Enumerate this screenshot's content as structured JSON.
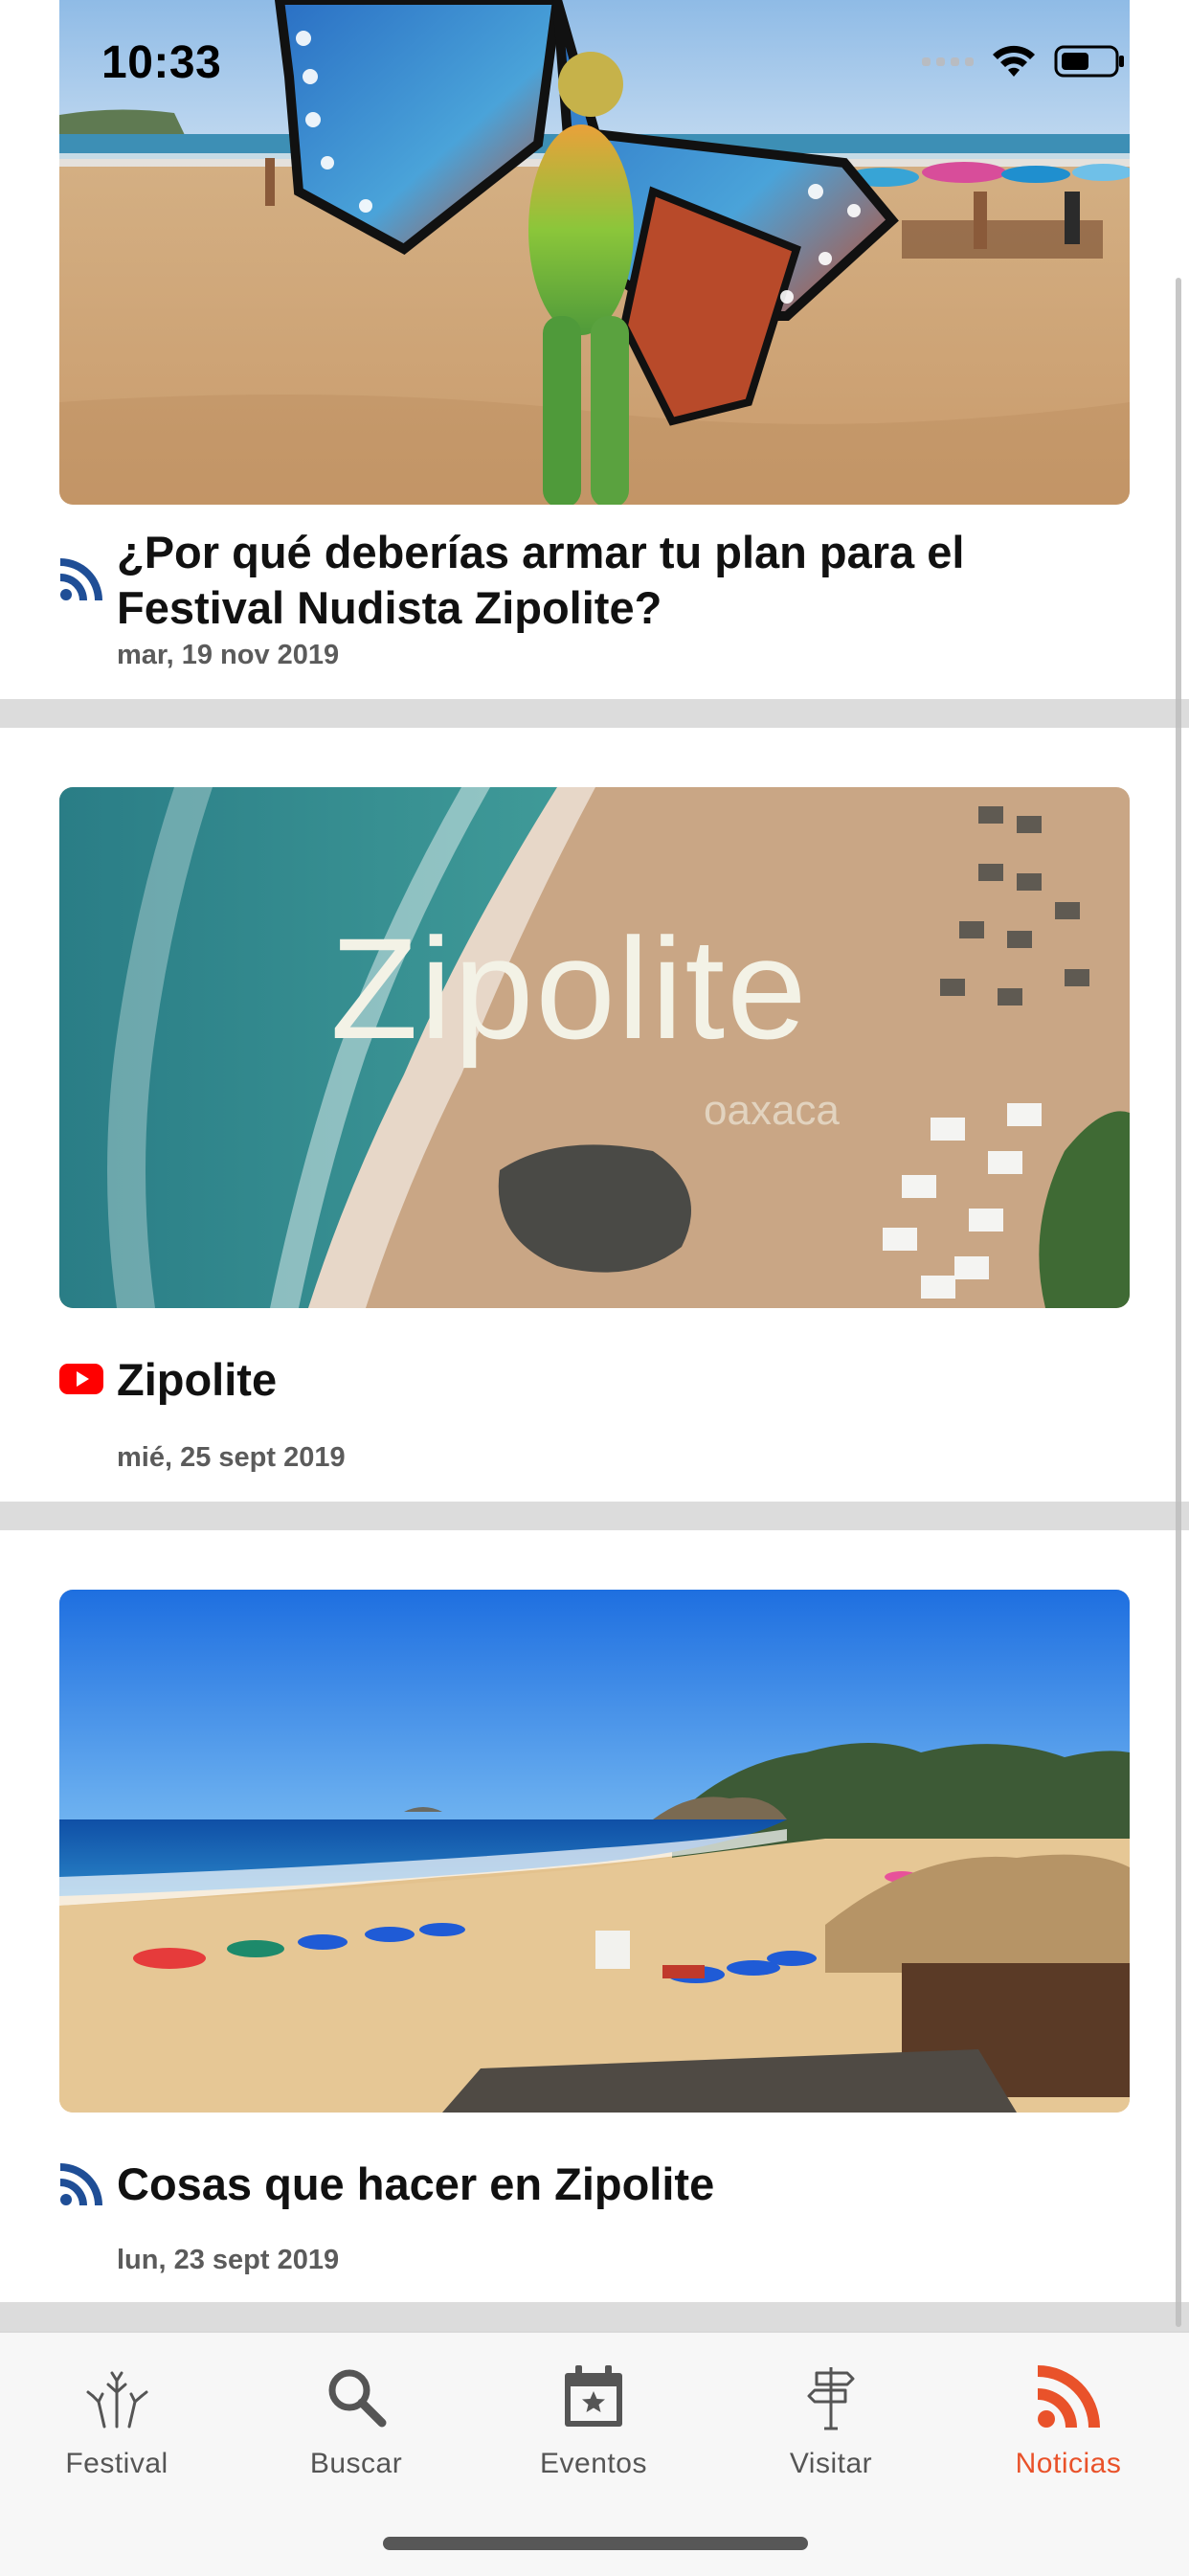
{
  "status_bar": {
    "time": "10:33"
  },
  "articles": [
    {
      "source_icon": "rss-icon",
      "title": "¿Por qué deberías armar tu plan para el Festival Nudista Zipolite?",
      "date": "mar, 19 nov 2019"
    },
    {
      "source_icon": "youtube-icon",
      "title": "Zipolite",
      "date": "mié, 25 sept 2019",
      "image_overlay_title": "Zipolite",
      "image_overlay_subtitle": "oaxaca"
    },
    {
      "source_icon": "rss-icon",
      "title": "Cosas que hacer en Zipolite",
      "date": "lun, 23 sept 2019"
    }
  ],
  "tab_bar": {
    "items": [
      {
        "label": "Festival",
        "icon": "fireworks-icon"
      },
      {
        "label": "Buscar",
        "icon": "search-icon"
      },
      {
        "label": "Eventos",
        "icon": "calendar-icon"
      },
      {
        "label": "Visitar",
        "icon": "signpost-icon"
      },
      {
        "label": "Noticias",
        "icon": "rss-icon",
        "active": true
      }
    ]
  },
  "colors": {
    "accent": "#e9522a",
    "rss_blue": "#1f4e96",
    "youtube_red": "#ff0000",
    "separator": "#dcdcdc"
  }
}
